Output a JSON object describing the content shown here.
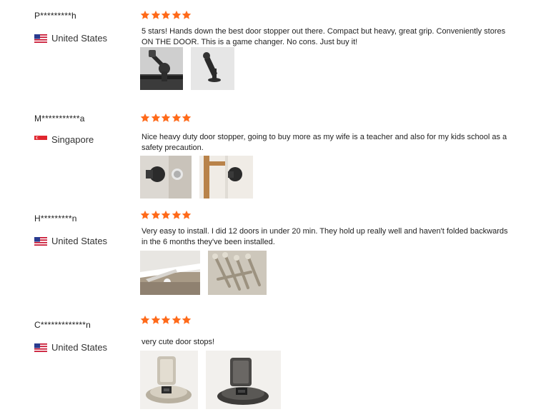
{
  "reviews": [
    {
      "username": "P*********h",
      "country": "United States",
      "flag": "us-flag-icon",
      "stars": 5,
      "text": "5 stars! Hands down the best door stopper out there. Compact but heavy, great grip. Conveniently stores ON THE DOOR. This is a game changer. No cons. Just buy it!",
      "photos": [
        "dark-door-stopper-mounted-photo",
        "black-door-stopper-product-photo"
      ]
    },
    {
      "username": "M***********a",
      "country": "Singapore",
      "flag": "sg-flag-icon",
      "stars": 5,
      "text": "Nice heavy duty door stopper, going to buy more as my wife is a teacher and also for my kids school as a safety precaution.",
      "photos": [
        "magnetic-stopper-on-wall-photo",
        "magnetic-stopper-wood-door-photo"
      ]
    },
    {
      "username": "H*********n",
      "country": "United States",
      "flag": "us-flag-icon",
      "stars": 5,
      "text": "Very easy to install. I did 12 doors in under 20 min. They hold up really well and haven't folded backwards in the 6 months they've been installed.",
      "photos": [
        "floor-door-stop-installed-photo",
        "pile-of-door-stops-photo"
      ]
    },
    {
      "username": "C*************n",
      "country": "United States",
      "flag": "us-flag-icon",
      "stars": 5,
      "text": "very cute door stops!",
      "photos": [
        "silver-floor-door-stop-photo",
        "gunmetal-floor-door-stop-photo"
      ]
    }
  ],
  "colors": {
    "star": "#ff6a1a",
    "text": "#222222"
  }
}
